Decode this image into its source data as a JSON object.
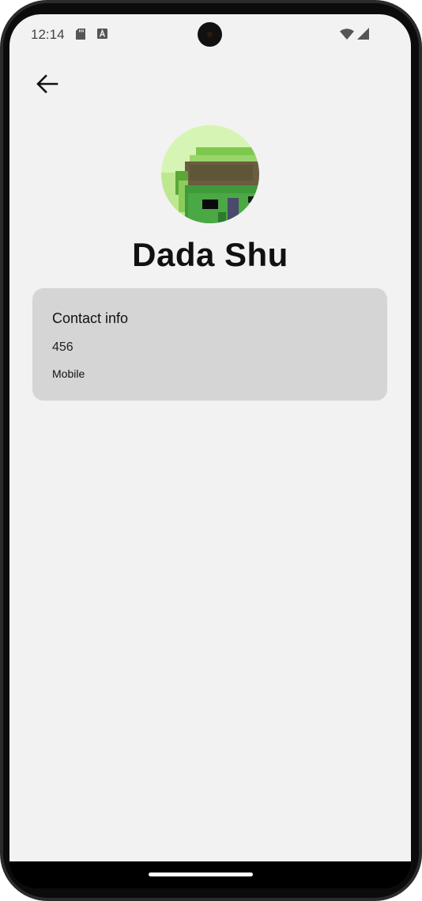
{
  "status_bar": {
    "time": "12:14",
    "icons": [
      "sd-card-icon",
      "a-badge-icon",
      "wifi-icon",
      "signal-icon"
    ]
  },
  "toolbar": {
    "back_icon": "arrow-left-icon"
  },
  "contact": {
    "name": "Dada Shu",
    "avatar_icon": "pixel-art-avatar"
  },
  "contact_info": {
    "title": "Contact info",
    "phone": "456",
    "phone_type": "Mobile"
  },
  "colors": {
    "screen_bg": "#f2f2f2",
    "card_bg": "#d5d5d5",
    "text": "#111111"
  }
}
